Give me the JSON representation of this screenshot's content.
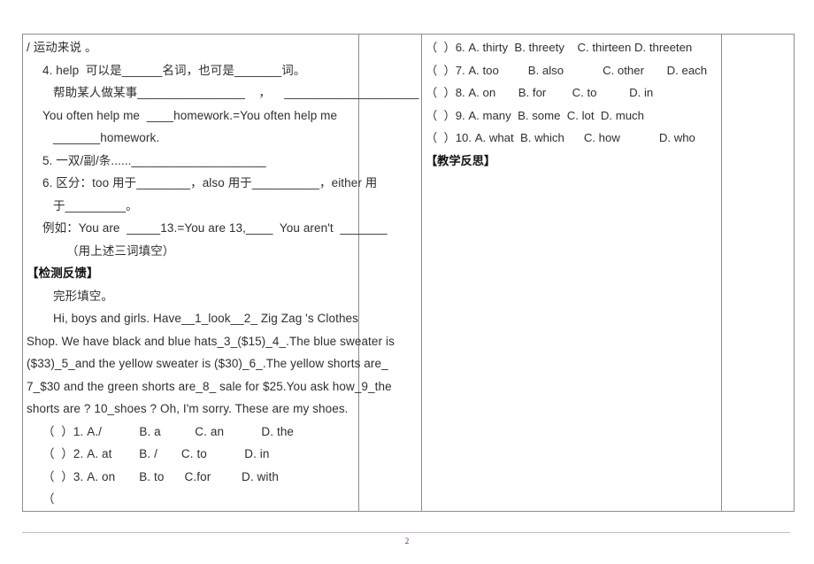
{
  "document": {
    "page_number": "2",
    "table": {
      "columns": [
        "left-content",
        "spacer",
        "right-content",
        "right-spacer"
      ]
    }
  },
  "left_column": {
    "lines": [
      {
        "text": "/ 运动来说 。",
        "indent": 0,
        "bold": false
      },
      {
        "text": "4. help  可以是______名词，也可是_______词。",
        "indent": 1,
        "bold": false
      },
      {
        "text": "帮助某人做某事________________    ，    ____________________",
        "indent": 2,
        "bold": false
      },
      {
        "text": "You often help me  ____homework.=You often help me",
        "indent": 1,
        "bold": false
      },
      {
        "text": "_______homework.",
        "indent": 2,
        "bold": false
      },
      {
        "text": "5. 一双/副/条......____________________",
        "indent": 1,
        "bold": false
      },
      {
        "text": "6. 区分：too 用于________，also 用于__________，either 用",
        "indent": 1,
        "bold": false
      },
      {
        "text": "于_________。",
        "indent": 2,
        "bold": false
      },
      {
        "text": "例如：You are  _____13.=You are 13,____  You aren't  _______",
        "indent": 1,
        "bold": false
      },
      {
        "text": "（用上述三词填空）",
        "indent": 3,
        "bold": false
      },
      {
        "text": "【检测反馈】",
        "indent": 0,
        "bold": true
      },
      {
        "text": "完形填空。",
        "indent": 2,
        "bold": false
      },
      {
        "text": "Hi, boys and girls. Have__1_look__2_ Zig Zag 's Clothes",
        "indent": 2,
        "bold": false
      },
      {
        "text": "Shop. We have black and blue hats_3_($15)_4_.The blue sweater is",
        "indent": 0,
        "bold": false
      },
      {
        "text": "($33)_5_and the yellow sweater is ($30)_6_.The yellow shorts are_",
        "indent": 0,
        "bold": false
      },
      {
        "text": "7_$30 and the green shorts are_8_ sale for $25.You ask how_9_the",
        "indent": 0,
        "bold": false
      },
      {
        "text": "shorts are ? 10_shoes ? Oh, I'm sorry. These are my shoes.",
        "indent": 0,
        "bold": false
      },
      {
        "text": "（  ）1. A./           B. a          C. an           D. the",
        "indent": 1,
        "bold": false
      },
      {
        "text": "（  ）2. A. at        B. /       C. to           D. in",
        "indent": 1,
        "bold": false
      },
      {
        "text": "（  ）3. A. on       B. to      C.for         D. with",
        "indent": 1,
        "bold": false
      },
      {
        "text": "（",
        "indent": 1,
        "bold": false
      }
    ]
  },
  "right_column": {
    "lines": [
      {
        "text": "（  ）6. A. thirty  B. threety    C. thirteen D. threeten",
        "bold": false
      },
      {
        "text": "（  ）7. A. too         B. also            C. other       D. each",
        "bold": false
      },
      {
        "text": "（  ）8. A. on       B. for        C. to          D. in",
        "bold": false
      },
      {
        "text": "（  ）9. A. many  B. some  C. lot  D. much",
        "bold": false
      },
      {
        "text": "（  ）10. A. what  B. which      C. how            D. who",
        "bold": false
      },
      {
        "text": "【教学反思】",
        "bold": true
      }
    ]
  }
}
